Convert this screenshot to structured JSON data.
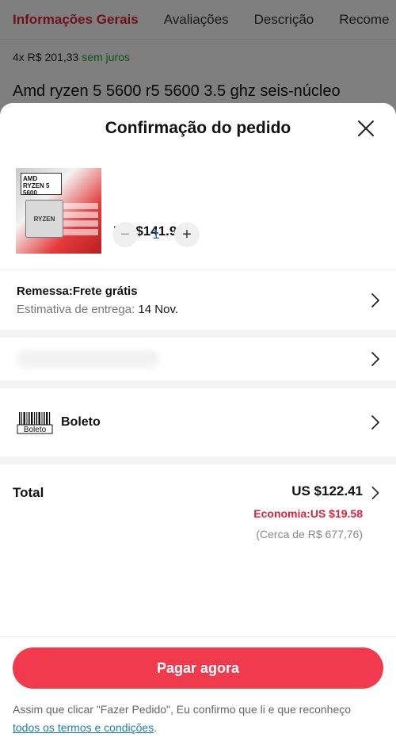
{
  "background": {
    "tabs": [
      "Informações Gerais",
      "Avaliações",
      "Descrição",
      "Recome"
    ],
    "installment": "4x R$ 201,33",
    "installment_note": "sem juros",
    "product_title": "Amd ryzen 5 5600 r5 5600 3.5 ghz seis-núcleo"
  },
  "sheet": {
    "title": "Confirmação do pedido",
    "product": {
      "image_box_text": "AMD\nRYZEN 5\n5600",
      "image_chip_text": "RYZEN",
      "price": "US $141.99",
      "quantity": "1"
    },
    "shipping": {
      "title": "Remessa:Frete grátis",
      "estimate_label": "Estimativa de entrega:",
      "estimate_date": "14 Nov."
    },
    "payment": {
      "logo_text": "Boleto",
      "label": "Boleto"
    },
    "total": {
      "label": "Total",
      "value": "US $122.41",
      "economy": "Economia:US $19.58",
      "approx": "(Cerca de R$ 677,76)"
    },
    "pay_button": "Pagar agora",
    "terms_text": "Assim que clicar \"Fazer Pedido\", Eu confirmo que li e que reconheço",
    "terms_link": "todos os termos e condições",
    "terms_end": "."
  },
  "colors": {
    "accent_red": "#f23a4e",
    "economy_red": "#e0203a",
    "link_blue": "#1a7fa8",
    "qty_blue": "#1a73c8"
  }
}
